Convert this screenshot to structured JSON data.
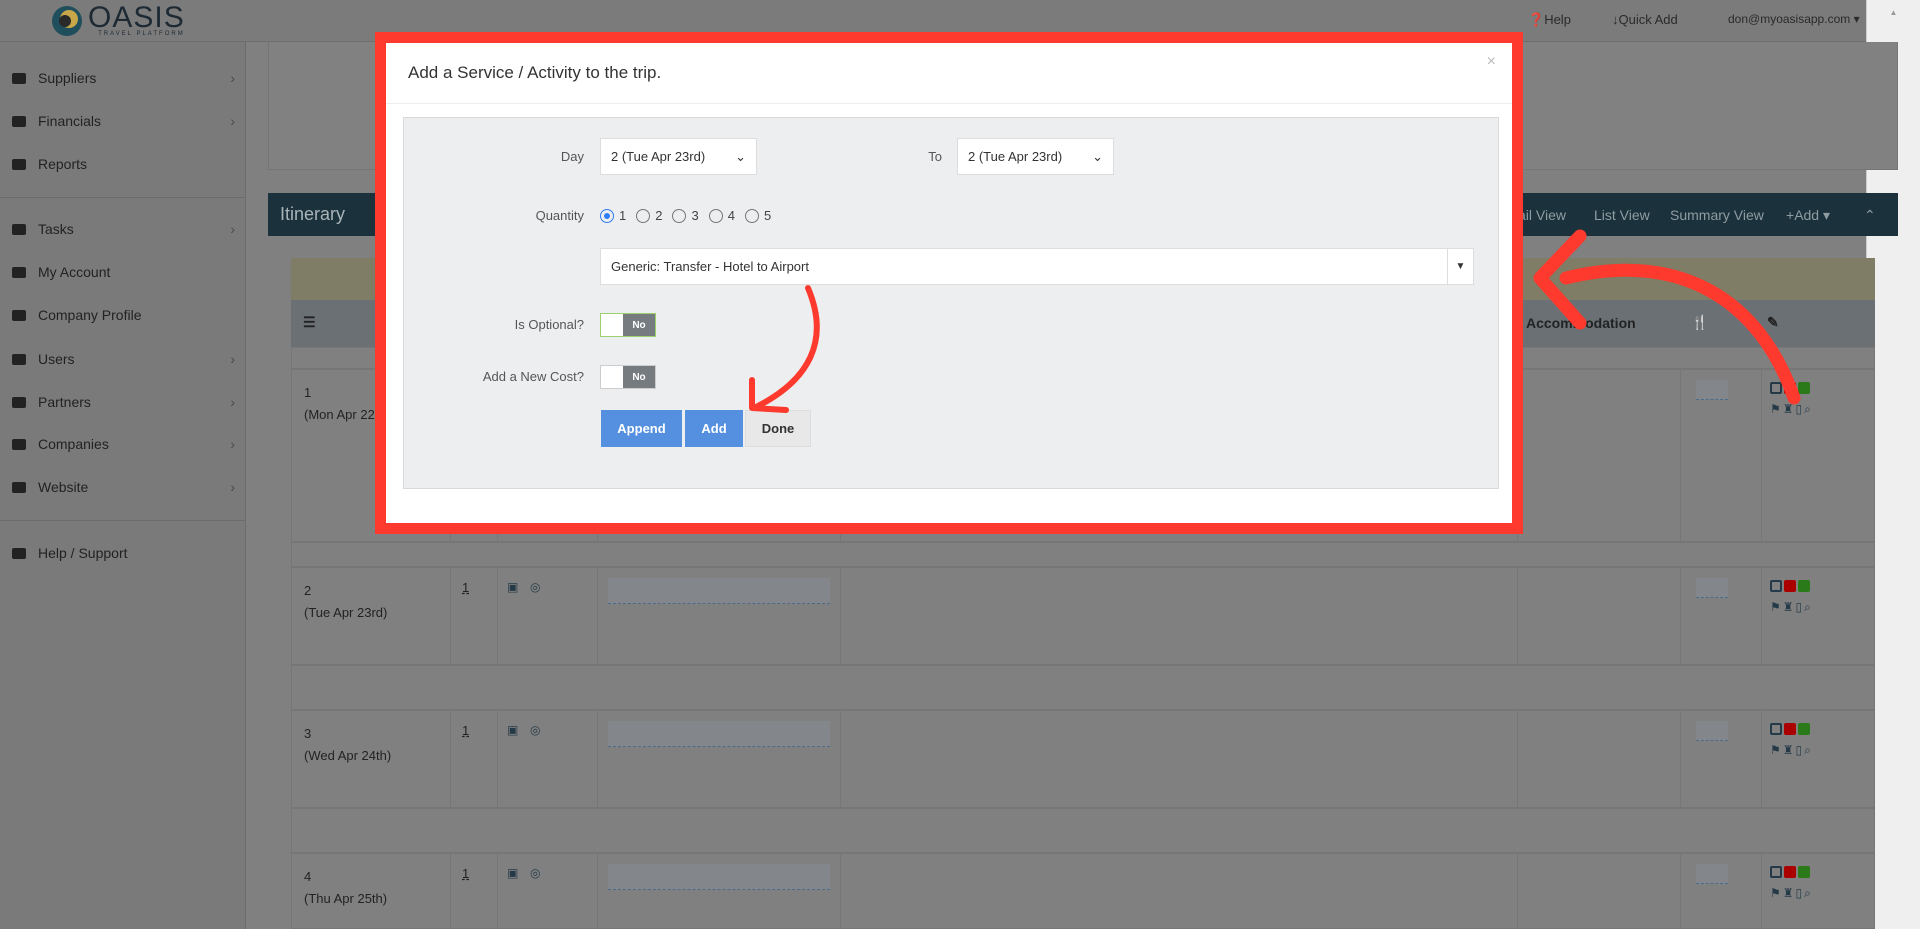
{
  "topbar": {
    "logo_text": "OASIS",
    "logo_sub": "TRAVEL PLATFORM",
    "help": "Help",
    "quick_add": "Quick Add",
    "user": "don@myoasisapp.com"
  },
  "sidebar": {
    "items": [
      {
        "label": "Suppliers",
        "icon": "archive-icon",
        "chevron": true
      },
      {
        "label": "Financials",
        "icon": "money-icon",
        "chevron": true
      },
      {
        "label": "Reports",
        "icon": "table-icon",
        "chevron": false
      },
      {
        "label": "Tasks",
        "icon": "check-icon",
        "chevron": true
      },
      {
        "label": "My Account",
        "icon": "gear-icon",
        "chevron": false
      },
      {
        "label": "Company Profile",
        "icon": "gears-icon",
        "chevron": false
      },
      {
        "label": "Users",
        "icon": "user-icon",
        "chevron": true
      },
      {
        "label": "Partners",
        "icon": "users-icon",
        "chevron": true
      },
      {
        "label": "Companies",
        "icon": "bank-icon",
        "chevron": true
      },
      {
        "label": "Website",
        "icon": "sitemap-icon",
        "chevron": true
      },
      {
        "label": "Help / Support",
        "icon": "question-circle-icon",
        "chevron": false
      }
    ]
  },
  "itinerary": {
    "title": "Itinerary",
    "tabs": [
      "ail View",
      "List View",
      "Summary View",
      "Add"
    ],
    "columns": {
      "accommodation": "Accommodation"
    },
    "days": [
      {
        "num": "1",
        "date": "(Mon Apr 22",
        "qty": ""
      },
      {
        "num": "2",
        "date": "(Tue Apr 23rd)",
        "qty": "1"
      },
      {
        "num": "3",
        "date": "(Wed Apr 24th)",
        "qty": "1"
      },
      {
        "num": "4",
        "date": "(Thu Apr 25th)",
        "qty": "1"
      }
    ]
  },
  "modal": {
    "title": "Add a Service / Activity to the trip.",
    "close": "×",
    "day_label": "Day",
    "day_value": "2 (Tue Apr 23rd)",
    "to_label": "To",
    "to_value": "2 (Tue Apr 23rd)",
    "quantity_label": "Quantity",
    "quantity_options": [
      "1",
      "2",
      "3",
      "4",
      "5"
    ],
    "quantity_selected": "1",
    "service_value": "Generic: Transfer - Hotel to Airport",
    "optional_label": "Is Optional?",
    "optional_state": "No",
    "new_cost_label": "Add a New Cost?",
    "new_cost_state": "No",
    "append": "Append",
    "add": "Add",
    "done": "Done"
  },
  "colors": {
    "annotation": "#fd3a2d",
    "primary": "#5590e0",
    "header": "#1b313b"
  }
}
